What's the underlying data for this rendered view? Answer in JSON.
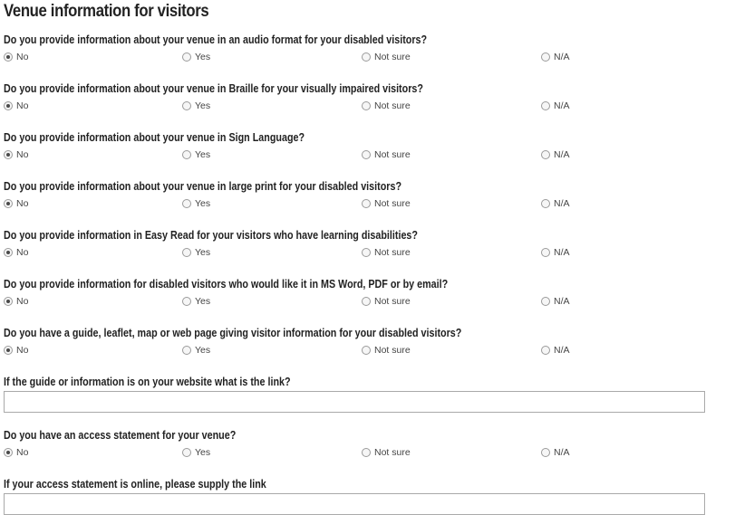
{
  "page_title": "Venue information for visitors",
  "option_labels": [
    "No",
    "Yes",
    "Not sure",
    "N/A"
  ],
  "questions": [
    {
      "label": "Do you provide information about your venue in an audio format for your disabled visitors?",
      "selected": "No"
    },
    {
      "label": "Do you provide information about your venue in Braille for your visually impaired visitors?",
      "selected": "No"
    },
    {
      "label": "Do you provide information about your venue in Sign Language?",
      "selected": "No"
    },
    {
      "label": "Do you provide information about your venue in large print for your disabled visitors?",
      "selected": "No"
    },
    {
      "label": "Do you provide information in Easy Read for your visitors who have learning disabilities?",
      "selected": "No"
    },
    {
      "label": "Do you provide information for disabled visitors who would like it in MS Word, PDF or by email?",
      "selected": "No"
    },
    {
      "label": "Do you have a guide, leaflet, map or web page giving visitor information for your disabled visitors?",
      "selected": "No"
    }
  ],
  "guide_link": {
    "label": "If the guide or information is on your website what is the link?",
    "value": ""
  },
  "access_statement": {
    "label": "Do you have an access statement for your venue?",
    "selected": "No"
  },
  "access_statement_link": {
    "label": "If your access statement is online, please supply the link",
    "value": ""
  }
}
